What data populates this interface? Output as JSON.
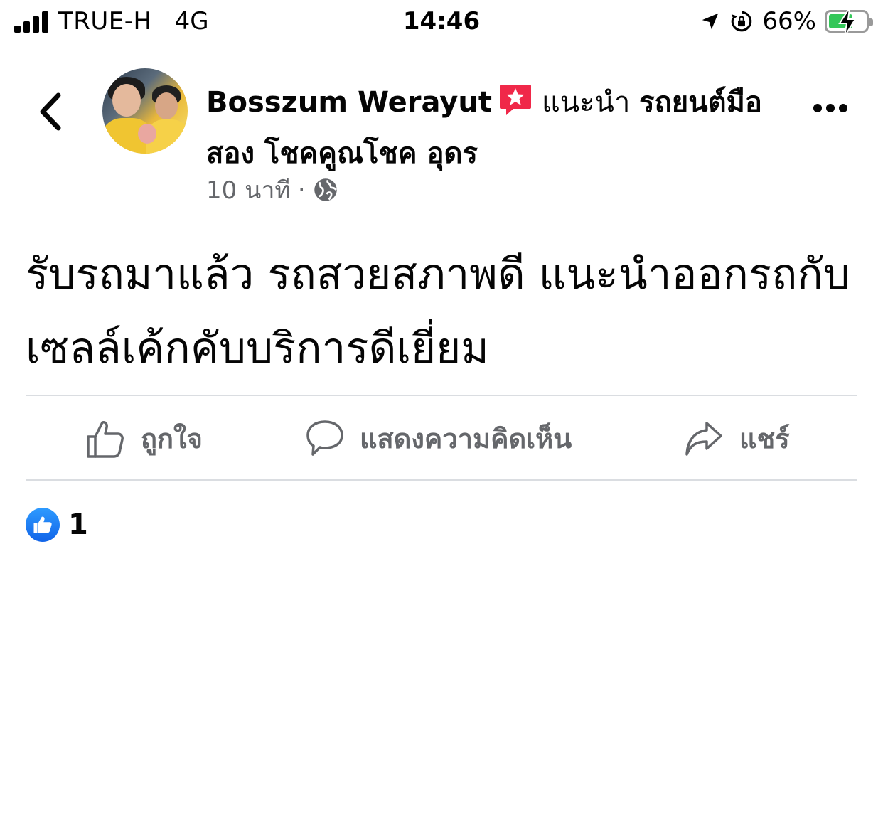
{
  "status_bar": {
    "carrier": "TRUE-H",
    "network": "4G",
    "time": "14:46",
    "battery_percent": "66%",
    "battery_level": 0.66,
    "icons": [
      "signal-icon",
      "location-arrow-icon",
      "orientation-lock-icon",
      "battery-charging-icon"
    ]
  },
  "header": {
    "author": "Bosszum Werayut",
    "recommends_text": "แนะนำ",
    "page_name": "รถยนต์มือสอง โชคคูณโชค อุดร",
    "time_ago": "10 นาที",
    "separator": "·",
    "privacy_icon": "globe-icon",
    "badge_icon": "recommendation-star-icon",
    "back_icon": "chevron-left-icon",
    "more_icon": "more-dots-icon"
  },
  "post": {
    "text": "รับรถมาแล้ว รถสวยสภาพดี แนะนำออกรถกับเซลล์เค้กคับบริการดีเยี่ยม"
  },
  "actions": {
    "like": "ถูกใจ",
    "comment": "แสดงความคิดเห็น",
    "share": "แชร์"
  },
  "reactions": {
    "count": "1",
    "icon": "like-reaction-icon"
  },
  "colors": {
    "text_primary": "#050505",
    "text_secondary": "#65676b",
    "divider": "#dadde1",
    "like_blue": "#1877f2",
    "badge_pink": "#f02849",
    "battery_green": "#34c759"
  }
}
